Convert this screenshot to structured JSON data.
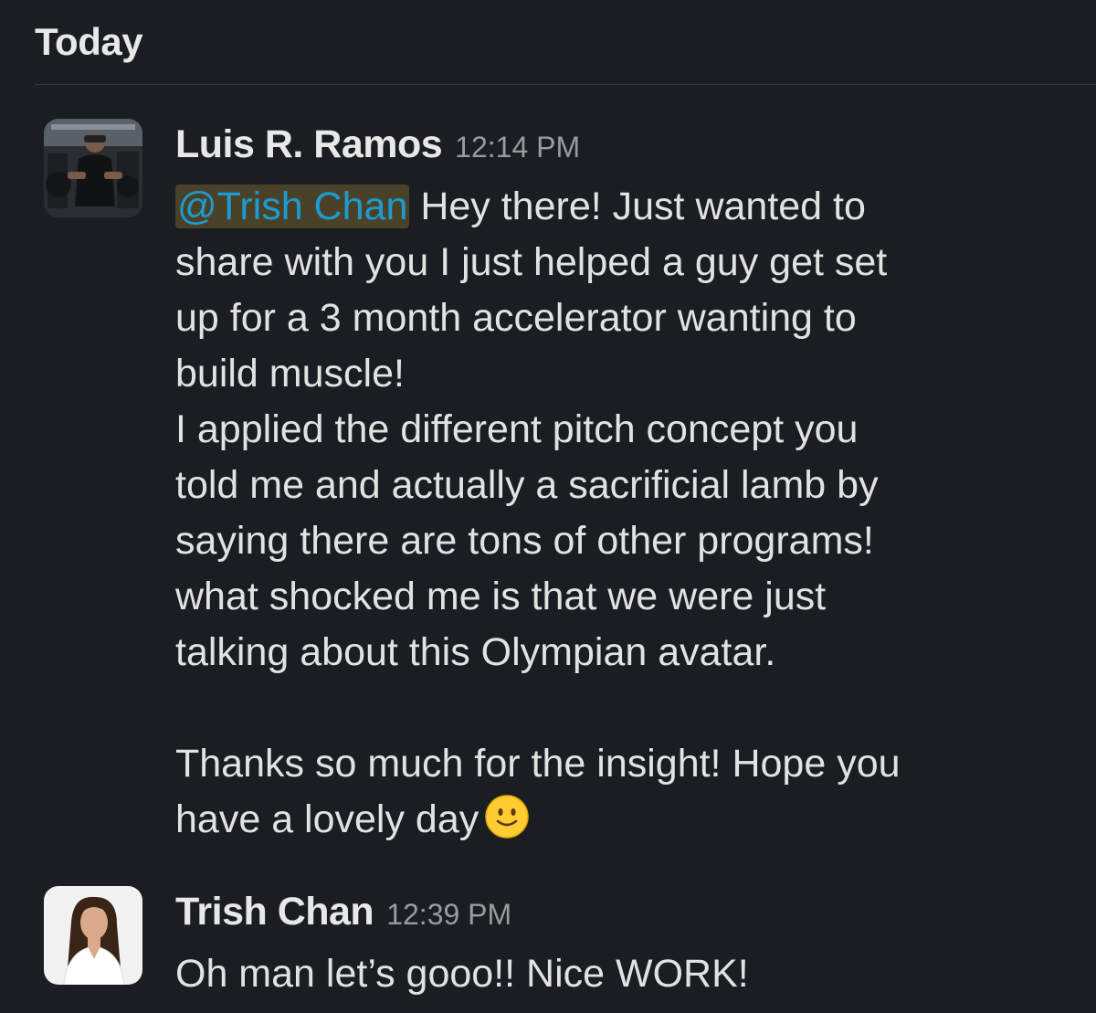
{
  "day_divider": {
    "label": "Today"
  },
  "messages": [
    {
      "sender": "Luis R. Ramos",
      "time": "12:14 PM",
      "avatar_icon": "user-avatar-gym-photo",
      "mention": "@Trish Chan",
      "lines": [
        "Hey there! Just wanted to",
        "share with you I just helped a guy get set",
        "up for a 3 month accelerator wanting to",
        "build muscle!",
        "I applied the different pitch concept you",
        "told me and actually a sacrificial lamb by",
        "saying there are tons of other programs!",
        "what shocked me is that we were just",
        "talking about this Olympian avatar.",
        "",
        "Thanks so much for the insight! Hope you",
        "have a lovely day"
      ],
      "trailing_emoji": "slightly-smiling-face-emoji"
    },
    {
      "sender": "Trish Chan",
      "time": "12:39 PM",
      "avatar_icon": "user-avatar-portrait-photo",
      "lines": [
        "Oh man let’s gooo!! Nice WORK!"
      ]
    }
  ],
  "colors": {
    "background": "#1a1d21",
    "mention_text": "#1d9bd1",
    "mention_highlight": "#f2c744",
    "timestamp": "#9a9b9d"
  }
}
